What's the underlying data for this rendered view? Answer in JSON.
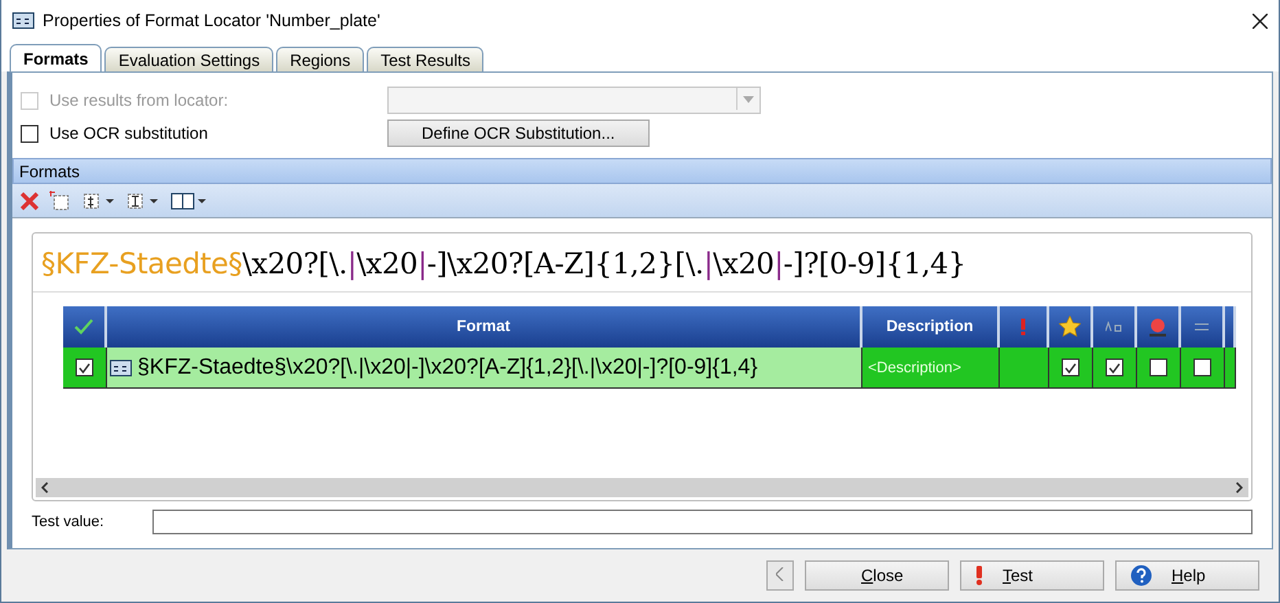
{
  "window": {
    "title": "Properties of Format Locator 'Number_plate'"
  },
  "tabs": [
    {
      "label": "Formats",
      "selected": true
    },
    {
      "label": "Evaluation Settings",
      "selected": false
    },
    {
      "label": "Regions",
      "selected": false
    },
    {
      "label": "Test Results",
      "selected": false
    }
  ],
  "use_results": {
    "label": "Use results from locator:",
    "checked": false,
    "disabled": true
  },
  "use_ocr": {
    "label": "Use OCR substitution",
    "checked": false,
    "disabled": false
  },
  "define_ocr_button": "Define OCR Substitution...",
  "formats_panel": {
    "title": "Formats"
  },
  "expression": [
    {
      "kind": "token",
      "text": "§KFZ-Staedte§"
    },
    {
      "kind": "literal",
      "text": "\\x20?[\\."
    },
    {
      "kind": "operator",
      "text": "|"
    },
    {
      "kind": "literal",
      "text": "\\x20"
    },
    {
      "kind": "operator",
      "text": "|"
    },
    {
      "kind": "literal",
      "text": "-]\\x20?[A-Z]{1,2}[\\."
    },
    {
      "kind": "operator",
      "text": "|"
    },
    {
      "kind": "literal",
      "text": "\\x20"
    },
    {
      "kind": "operator",
      "text": "|"
    },
    {
      "kind": "literal",
      "text": "-]?[0-9]{1,4}"
    }
  ],
  "table": {
    "columns": [
      {
        "kind": "enabled"
      },
      {
        "kind": "text",
        "label": "Format"
      },
      {
        "kind": "text",
        "label": "Description"
      },
      {
        "kind": "exclaim"
      },
      {
        "kind": "star"
      },
      {
        "kind": "case"
      },
      {
        "kind": "stamp"
      },
      {
        "kind": "equals"
      },
      {
        "kind": "partial"
      }
    ],
    "rows": [
      {
        "enabled": true,
        "format": "§KFZ-Staedte§\\x20?[\\.|\\x20|-]\\x20?[A-Z]{1,2}[\\.|\\x20|-]?[0-9]{1,4}",
        "description": "<Description>",
        "flags": [
          true,
          true,
          false,
          false
        ]
      }
    ]
  },
  "test_value": {
    "label": "Test value:"
  },
  "buttons": [
    {
      "kind": "close",
      "label": "Close"
    },
    {
      "kind": "test",
      "label": "Test"
    },
    {
      "kind": "help",
      "label": "Help"
    }
  ]
}
